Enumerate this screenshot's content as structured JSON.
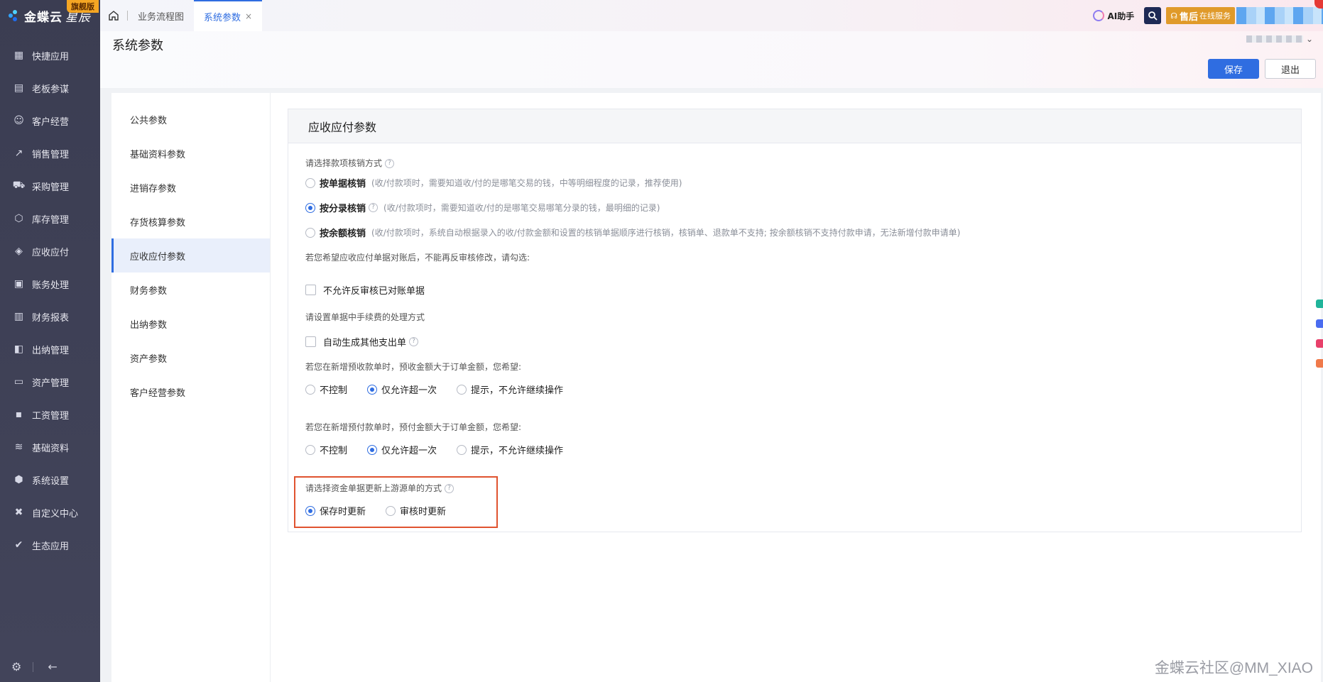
{
  "app": {
    "brand": "金蝶云",
    "product": "星辰",
    "edition_badge": "旗舰版"
  },
  "sidebar": {
    "items": [
      {
        "label": "快捷应用",
        "icon": "grid-apps-icon"
      },
      {
        "label": "老板参谋",
        "icon": "chart-board-icon"
      },
      {
        "label": "客户经营",
        "icon": "customer-icon"
      },
      {
        "label": "销售管理",
        "icon": "sales-trend-icon"
      },
      {
        "label": "采购管理",
        "icon": "cart-icon"
      },
      {
        "label": "库存管理",
        "icon": "box-icon"
      },
      {
        "label": "应收应付",
        "icon": "diamond-icon"
      },
      {
        "label": "账务处理",
        "icon": "ledger-icon"
      },
      {
        "label": "财务报表",
        "icon": "report-icon"
      },
      {
        "label": "出纳管理",
        "icon": "cashier-icon"
      },
      {
        "label": "资产管理",
        "icon": "asset-icon"
      },
      {
        "label": "工资管理",
        "icon": "wallet-icon"
      },
      {
        "label": "基础资料",
        "icon": "layers-icon"
      },
      {
        "label": "系统设置",
        "icon": "settings-hex-icon"
      },
      {
        "label": "自定义中心",
        "icon": "custom-cross-icon"
      },
      {
        "label": "生态应用",
        "icon": "ecology-check-icon"
      }
    ],
    "footer": {
      "settings_icon": "gear-icon",
      "collapse_icon": "arrow-left-icon"
    }
  },
  "tabs": [
    {
      "label": "业务流程图"
    },
    {
      "label": "系统参数",
      "close": "×"
    }
  ],
  "topbar": {
    "ai_label": "AI助手",
    "service_label": "售后",
    "service_sub": "在线服务"
  },
  "page": {
    "title": "系统参数",
    "save_label": "保存",
    "exit_label": "退出"
  },
  "settings_nav": [
    {
      "label": "公共参数"
    },
    {
      "label": "基础资料参数"
    },
    {
      "label": "进销存参数"
    },
    {
      "label": "存货核算参数"
    },
    {
      "label": "应收应付参数",
      "active": true
    },
    {
      "label": "财务参数"
    },
    {
      "label": "出纳参数"
    },
    {
      "label": "资产参数"
    },
    {
      "label": "客户经营参数"
    }
  ],
  "panel": {
    "title": "应收应付参数",
    "q1": "请选择款项核销方式",
    "q1_options": [
      {
        "label": "按单据核销",
        "hint": "(收/付款项时，需要知道收/付的是哪笔交易的钱，中等明细程度的记录，推荐使用)",
        "selected": false
      },
      {
        "label": "按分录核销",
        "hint": "(收/付款项时，需要知道收/付的是哪笔交易哪笔分录的钱，最明细的记录)",
        "selected": true
      },
      {
        "label": "按余额核销",
        "hint": "(收/付款项时，系统自动根据录入的收/付款金额和设置的核销单据顺序进行核销，核销单、退款单不支持; 按余额核销不支持付款申请，无法新增付款申请单)",
        "selected": false
      }
    ],
    "q2": "若您希望应收应付单据对账后，不能再反审核修改，请勾选:",
    "q2_checkbox": "不允许反审核已对账单据",
    "q3": "请设置单据中手续费的处理方式",
    "q3_checkbox": "自动生成其他支出单",
    "q4": "若您在新增预收款单时，预收金额大于订单金额，您希望:",
    "q4_options": [
      {
        "label": "不控制",
        "selected": false
      },
      {
        "label": "仅允许超一次",
        "selected": true
      },
      {
        "label": "提示，不允许继续操作",
        "selected": false
      }
    ],
    "q5": "若您在新增预付款单时，预付金额大于订单金额，您希望:",
    "q5_options": [
      {
        "label": "不控制",
        "selected": false
      },
      {
        "label": "仅允许超一次",
        "selected": true
      },
      {
        "label": "提示，不允许继续操作",
        "selected": false
      }
    ],
    "q6": "请选择资金单据更新上游源单的方式",
    "q6_options": [
      {
        "label": "保存时更新",
        "selected": true
      },
      {
        "label": "审核时更新",
        "selected": false
      }
    ]
  },
  "watermark": "金蝶云社区@MM_XIAO",
  "colors": {
    "accent": "#2f6de1",
    "highlight": "#e0532f",
    "sidebar": "#3b3d52"
  }
}
